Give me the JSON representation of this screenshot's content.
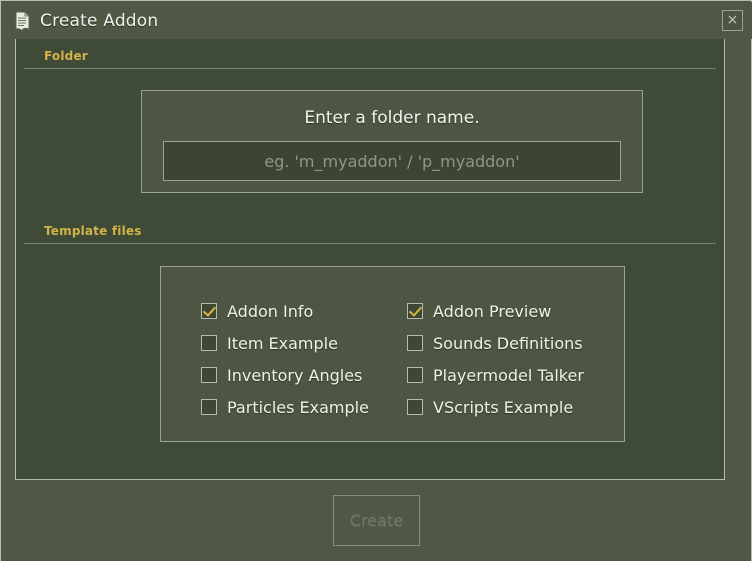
{
  "window": {
    "title": "Create Addon",
    "icon": "document-page-icon",
    "close_label": "×",
    "colors": {
      "titlebar_bg": "#4e5844",
      "panel_bg": "#3f4a37",
      "group_bg": "#4c5643",
      "input_bg": "#3c4534",
      "border": "#9ba391",
      "accent_label": "#d2b24a",
      "check_mark": "#d8b83f",
      "text": "#eff2e9",
      "disabled_text": "#6f7866"
    }
  },
  "sections": {
    "folder": {
      "label": "Folder",
      "prompt": "Enter a folder name.",
      "input_value": "",
      "input_placeholder": "eg. 'm_myaddon' / 'p_myaddon'"
    },
    "template": {
      "label": "Template files",
      "columns": [
        {
          "items": [
            {
              "label": "Addon Info",
              "checked": true
            },
            {
              "label": "Item Example",
              "checked": false
            },
            {
              "label": "Inventory Angles",
              "checked": false
            },
            {
              "label": "Particles Example",
              "checked": false
            }
          ]
        },
        {
          "items": [
            {
              "label": "Addon Preview",
              "checked": true
            },
            {
              "label": "Sounds Definitions",
              "checked": false
            },
            {
              "label": "Playermodel Talker",
              "checked": false
            },
            {
              "label": "VScripts Example",
              "checked": false
            }
          ]
        }
      ]
    }
  },
  "footer": {
    "create_label": "Create",
    "create_enabled": false
  }
}
